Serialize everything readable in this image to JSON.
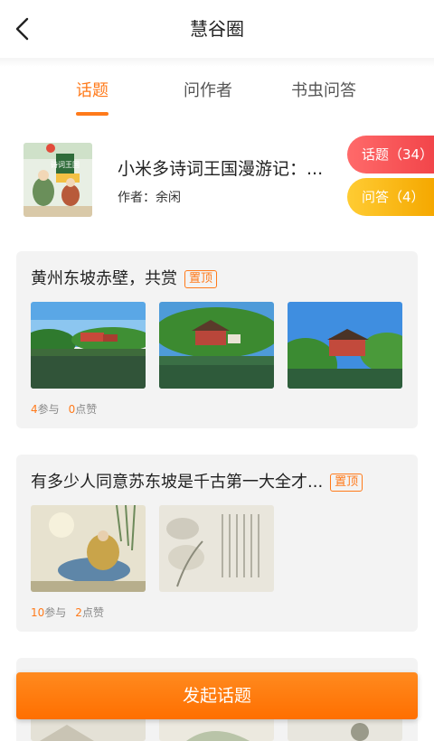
{
  "header": {
    "title": "慧谷圈"
  },
  "tabs": [
    {
      "label": "话题",
      "active": true
    },
    {
      "label": "问作者",
      "active": false
    },
    {
      "label": "书虫问答",
      "active": false
    }
  ],
  "book": {
    "title": "小米多诗词王国漫游记：...",
    "author": "作者：余闲",
    "cover_text": "诗词王国"
  },
  "side_buttons": {
    "topics": "话题（34）",
    "qa": "问答（4）"
  },
  "cards": [
    {
      "title": "黄州东坡赤壁，共赏",
      "pinned_label": "置顶",
      "participants": "4",
      "participants_label": "参与",
      "likes": "0",
      "likes_label": "点赞"
    },
    {
      "title": "有多少人同意苏东坡是千古第一大全才...",
      "pinned_label": "置顶",
      "participants": "10",
      "participants_label": "参与",
      "likes": "2",
      "likes_label": "点赞"
    }
  ],
  "cta": {
    "label": "发起话题"
  },
  "colors": {
    "accent": "#ff7a1a",
    "topics_pill": "#f2454a",
    "qa_pill": "#f5a800",
    "card_bg": "#f3f3f3"
  }
}
